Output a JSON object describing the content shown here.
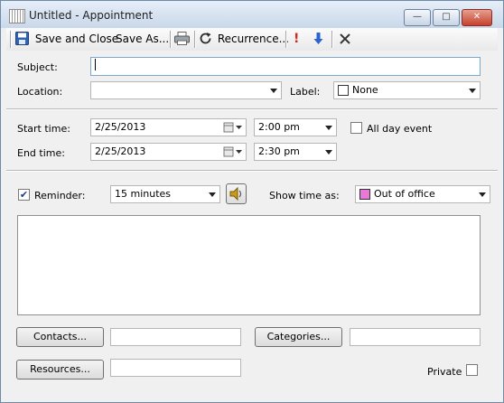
{
  "window": {
    "title": "Untitled - Appointment"
  },
  "toolbar": {
    "save_close": "Save and Close",
    "save_as": "Save As...",
    "recurrence": "Recurrence..."
  },
  "form": {
    "subject_label": "Subject:",
    "subject_value": "",
    "location_label": "Location:",
    "location_value": "",
    "label_label": "Label:",
    "label_value": "None",
    "label_color": "#ffffff",
    "start_label": "Start time:",
    "start_date": "2/25/2013",
    "start_time": "2:00 pm",
    "end_label": "End time:",
    "end_date": "2/25/2013",
    "end_time": "2:30 pm",
    "all_day_label": "All day event",
    "all_day_checked": false,
    "reminder_label": "Reminder:",
    "reminder_checked": true,
    "reminder_value": "15 minutes",
    "show_as_label": "Show time as:",
    "show_as_value": "Out of office",
    "show_as_color": "#e879d8",
    "notes": "",
    "contacts_button": "Contacts...",
    "contacts_value": "",
    "categories_button": "Categories...",
    "categories_value": "",
    "resources_button": "Resources...",
    "resources_value": "",
    "private_label": "Private",
    "private_checked": false
  },
  "colors": {
    "accent": "#2f63b4",
    "importance_high": "#d22b1e",
    "importance_low": "#2b63d2"
  }
}
